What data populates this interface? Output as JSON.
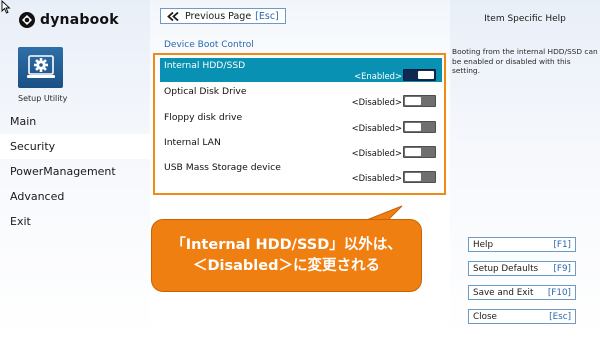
{
  "brand": {
    "name": "dynabook"
  },
  "sidebar": {
    "setup_caption": "Setup Utility",
    "items": [
      {
        "label": "Main"
      },
      {
        "label": "Security"
      },
      {
        "label": "PowerManagement"
      },
      {
        "label": "Advanced"
      },
      {
        "label": "Exit"
      }
    ]
  },
  "main": {
    "prev_button": {
      "label": "Previous Page",
      "key": "[Esc]"
    },
    "section_title": "Device Boot Control",
    "options": [
      {
        "label": "Internal HDD/SSD",
        "state": "<Enabled>",
        "enabled": true
      },
      {
        "label": "Optical Disk Drive",
        "state": "<Disabled>",
        "enabled": false
      },
      {
        "label": "Floppy disk drive",
        "state": "<Disabled>",
        "enabled": false
      },
      {
        "label": "Internal LAN",
        "state": "<Disabled>",
        "enabled": false
      },
      {
        "label": "USB Mass Storage device",
        "state": "<Disabled>",
        "enabled": false
      }
    ]
  },
  "callout": {
    "line1": "「Internal HDD/SSD」以外は、",
    "line2": "＜Disabled＞に変更される"
  },
  "help": {
    "title": "Item Specific Help",
    "text": "Booting from the internal HDD/SSD can be enabled or disabled with this setting.",
    "buttons": [
      {
        "label": "Help",
        "key": "[F1]"
      },
      {
        "label": "Setup Defaults",
        "key": "[F9]"
      },
      {
        "label": "Save and Exit",
        "key": "[F10]"
      },
      {
        "label": "Close",
        "key": "[Esc]"
      }
    ]
  },
  "colors": {
    "accent": "#2a68ad",
    "selected_row": "#0891b2",
    "highlight": "#ef8a17",
    "callout": "#f07f12"
  }
}
